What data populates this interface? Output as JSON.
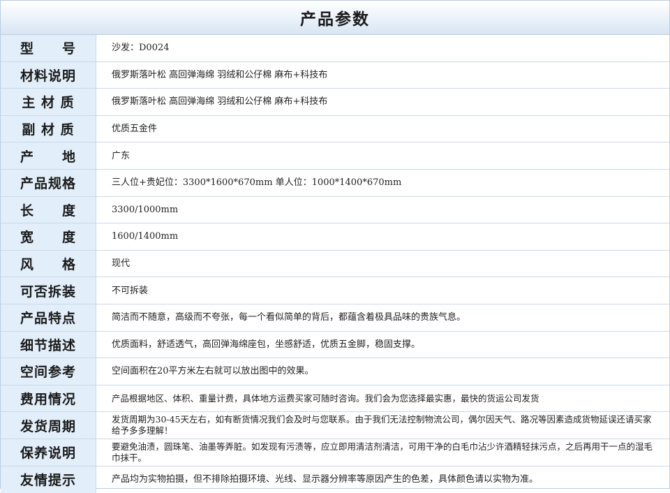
{
  "title": "产品参数",
  "rows": [
    {
      "label": "型　　号",
      "value": "沙发：D0024"
    },
    {
      "label": "材料说明",
      "value": "俄罗斯落叶松 高回弹海绵 羽绒和公仔棉 麻布+科技布"
    },
    {
      "label": "主 材 质",
      "value": "俄罗斯落叶松 高回弹海绵 羽绒和公仔棉 麻布+科技布"
    },
    {
      "label": "副 材 质",
      "value": "优质五金件"
    },
    {
      "label": "产　　地",
      "value": "广东"
    },
    {
      "label": "产品规格",
      "value": "三人位+贵妃位：3300*1600*670mm 单人位：1000*1400*670mm"
    },
    {
      "label": "长　　度",
      "value": "3300/1000mm"
    },
    {
      "label": "宽　　度",
      "value": "1600/1400mm"
    },
    {
      "label": "风　　格",
      "value": "现代"
    },
    {
      "label": "可否拆装",
      "value": "不可拆装"
    },
    {
      "label": "产品特点",
      "value": "简洁而不随意，高级而不夸张，每一个看似简单的背后，都蕴含着极具品味的贵族气息。"
    },
    {
      "label": "细节描述",
      "value": "优质面料，舒适透气，高回弹海绵座包，坐感舒适，优质五金脚，稳固支撑。"
    },
    {
      "label": "空间参考",
      "value": "空间面积在20平方米左右就可以放出图中的效果。"
    },
    {
      "label": "费用情况",
      "value": "产品根据地区、体积、重量计费，具体地方运费买家可随时咨询。我们会为您选择最实惠，最快的货运公司发货"
    },
    {
      "label": "发货周期",
      "value": "发货周期为30-45天左右，如有断货情况我们会及时与您联系。由于我们无法控制物流公司，偶尔因天气、路况等因素造成货物延误还请买家给予多多理解！"
    },
    {
      "label": "保养说明",
      "value": "要避免油渍，圆珠笔、油墨等弄脏。如发现有污渍等，应立即用清洁剂清洁，可用干净的白毛巾沾少许酒精轻抹污点，之后再用干一点的湿毛巾抹干。"
    },
    {
      "label": "友情提示",
      "value": "产品均为实物拍摄，但不排除拍摄环境、光线、显示器分辨率等原因产生的色差，具体颜色请以实物为准。"
    }
  ]
}
